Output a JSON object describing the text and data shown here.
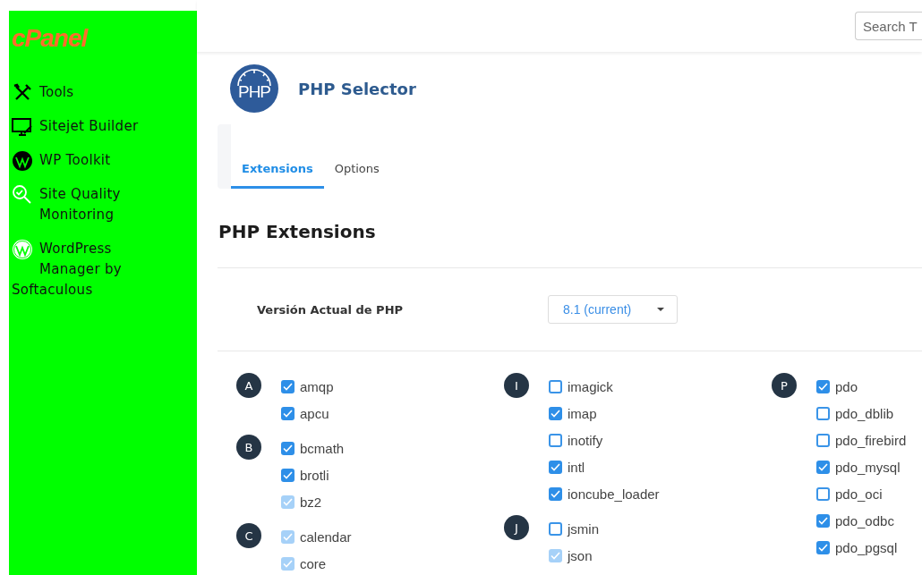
{
  "sidebar": {
    "logo": "cPanel",
    "items": [
      {
        "label": "Tools"
      },
      {
        "label": "Sitejet Builder"
      },
      {
        "label": "WP Toolkit"
      },
      {
        "label": "Site Quality Monitoring"
      },
      {
        "label": "WordPress Manager by Softaculous"
      }
    ]
  },
  "header": {
    "search": {
      "placeholder": "Search T"
    }
  },
  "page": {
    "title": "PHP Selector",
    "logo_text": "PHP"
  },
  "tabs": [
    {
      "label": "Extensions",
      "selected": true
    },
    {
      "label": "Options",
      "selected": false
    }
  ],
  "section_title": "PHP Extensions",
  "version": {
    "label": "Versión Actual de PHP",
    "value": "8.1 (current)"
  },
  "columns": [
    {
      "groups": [
        {
          "letter": "A",
          "items": [
            {
              "name": "amqp",
              "checked": true,
              "disabled": false
            },
            {
              "name": "apcu",
              "checked": true,
              "disabled": false
            }
          ]
        },
        {
          "letter": "B",
          "items": [
            {
              "name": "bcmath",
              "checked": true,
              "disabled": false
            },
            {
              "name": "brotli",
              "checked": true,
              "disabled": false
            },
            {
              "name": "bz2",
              "checked": true,
              "disabled": true
            }
          ]
        },
        {
          "letter": "C",
          "items": [
            {
              "name": "calendar",
              "checked": true,
              "disabled": true
            },
            {
              "name": "core",
              "checked": true,
              "disabled": true
            }
          ]
        }
      ]
    },
    {
      "groups": [
        {
          "letter": "I",
          "items": [
            {
              "name": "imagick",
              "checked": false,
              "disabled": false
            },
            {
              "name": "imap",
              "checked": true,
              "disabled": false
            },
            {
              "name": "inotify",
              "checked": false,
              "disabled": false
            },
            {
              "name": "intl",
              "checked": true,
              "disabled": false
            },
            {
              "name": "ioncube_loader",
              "checked": true,
              "disabled": false
            }
          ]
        },
        {
          "letter": "J",
          "items": [
            {
              "name": "jsmin",
              "checked": false,
              "disabled": false
            },
            {
              "name": "json",
              "checked": true,
              "disabled": true
            }
          ]
        }
      ]
    },
    {
      "groups": [
        {
          "letter": "P",
          "items": [
            {
              "name": "pdo",
              "checked": true,
              "disabled": false
            },
            {
              "name": "pdo_dblib",
              "checked": false,
              "disabled": false
            },
            {
              "name": "pdo_firebird",
              "checked": false,
              "disabled": false
            },
            {
              "name": "pdo_mysql",
              "checked": true,
              "disabled": false
            },
            {
              "name": "pdo_oci",
              "checked": false,
              "disabled": false
            },
            {
              "name": "pdo_odbc",
              "checked": true,
              "disabled": false
            },
            {
              "name": "pdo_pgsql",
              "checked": true,
              "disabled": false
            }
          ]
        }
      ]
    }
  ]
}
